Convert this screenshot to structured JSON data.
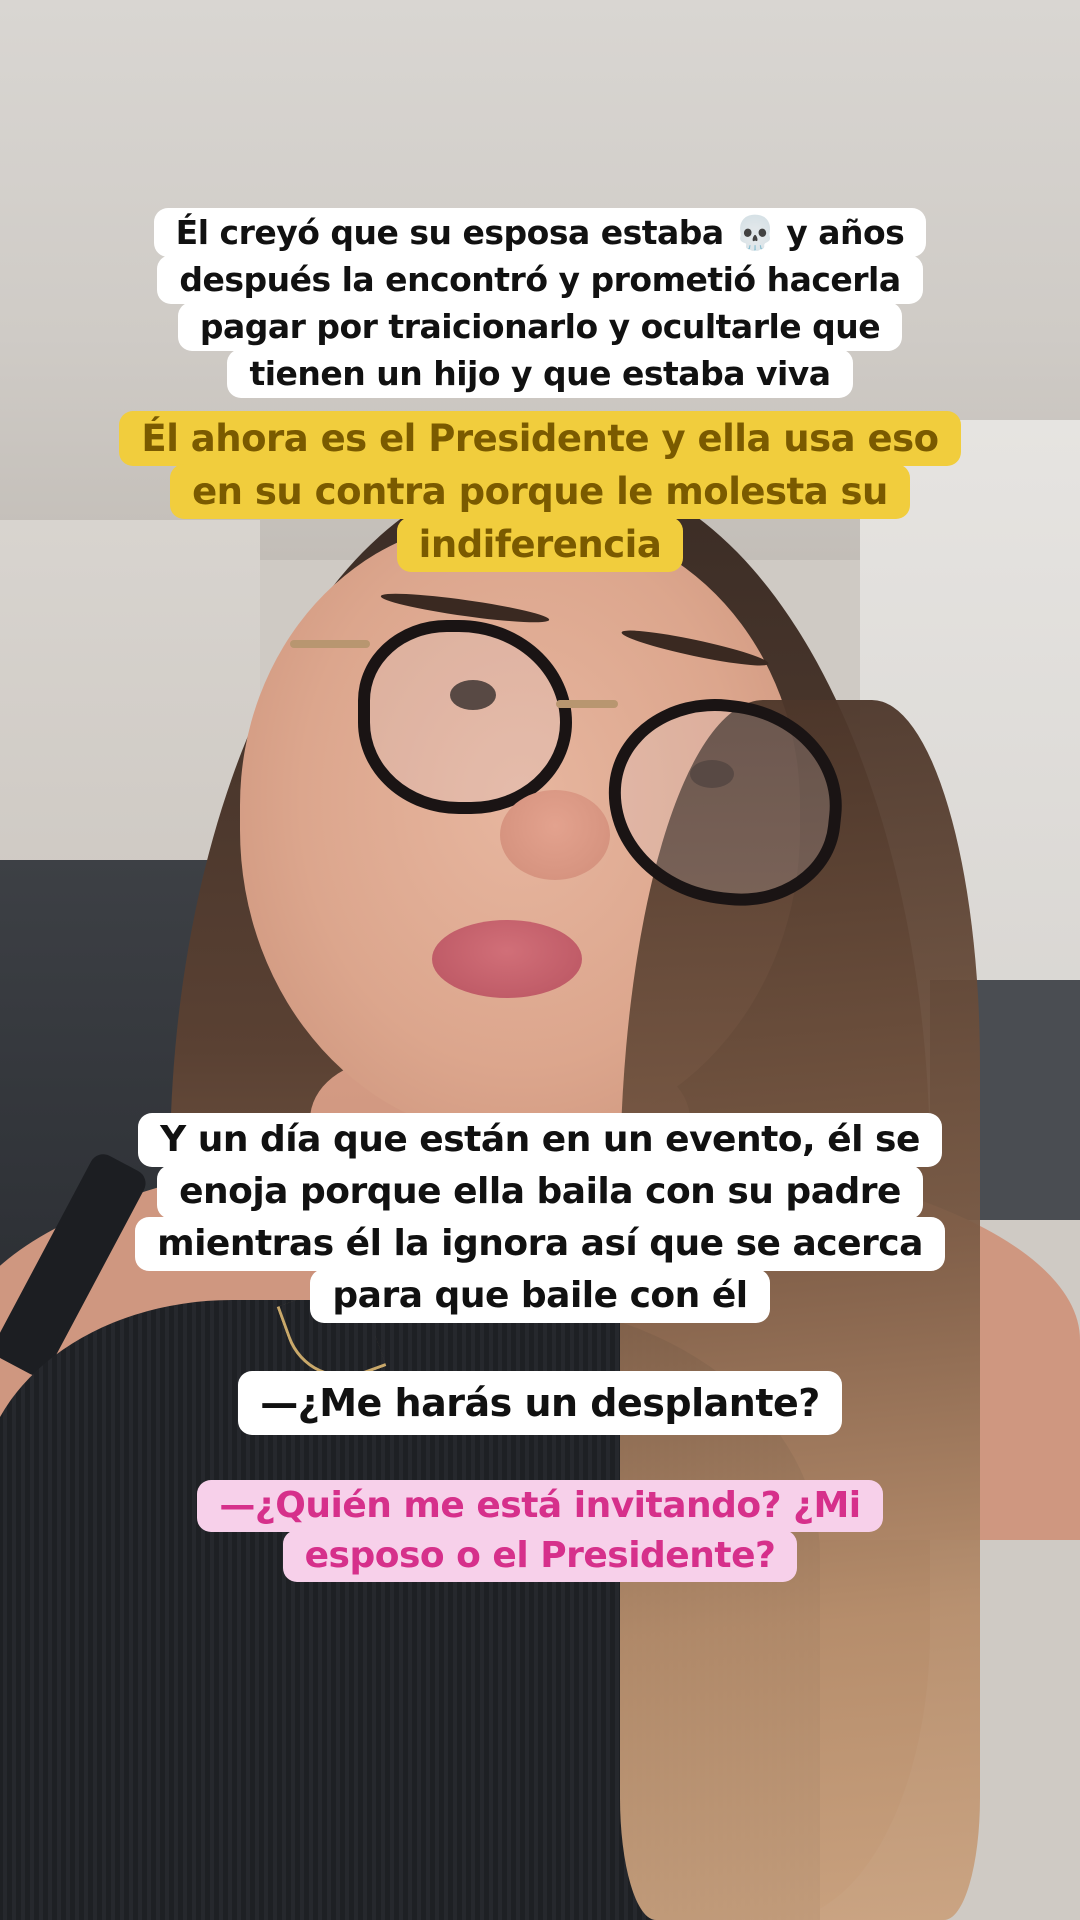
{
  "captions": {
    "intro": {
      "lines": [
        "Él creyó que su esposa estaba 💀 y años",
        "después la encontró y prometió hacerla",
        "pagar por traicionarlo y ocultarle que",
        "tienen un hijo y que estaba viva"
      ]
    },
    "highlight": {
      "lines": [
        "Él ahora es el Presidente y ella usa eso",
        "en su contra porque le molesta su",
        "indiferencia"
      ]
    },
    "event": {
      "lines": [
        "Y un día que están en un evento, él se",
        "enoja porque ella baila con su padre",
        "mientras él la ignora así que se acerca",
        "para que baile con él"
      ]
    },
    "dialogue_him": {
      "lines": [
        "—¿Me harás un desplante?"
      ]
    },
    "dialogue_her": {
      "lines": [
        "—¿Quién me está invitando? ¿Mi",
        "esposo o el Presidente?"
      ]
    }
  },
  "colors": {
    "white_bubble": "#ffffff",
    "yellow_bubble": "#f1cd3d",
    "yellow_text": "#7a5a00",
    "pink_bubble": "#f7d0ea",
    "pink_text": "#d6308b"
  }
}
